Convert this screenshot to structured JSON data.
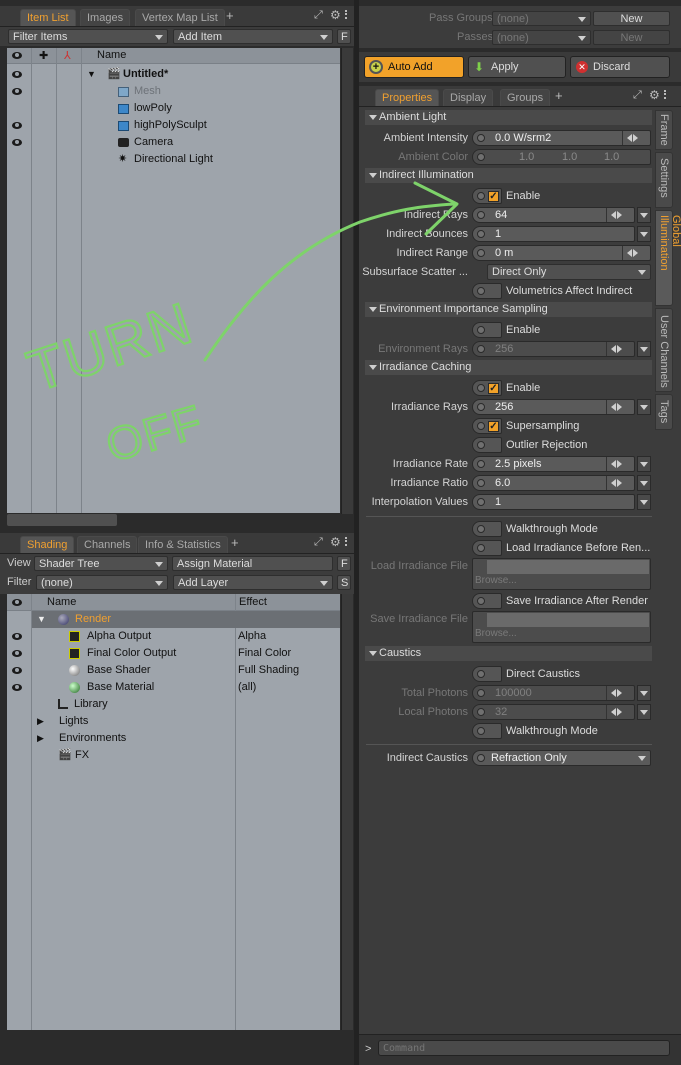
{
  "itemlist": {
    "tabs": [
      "Item List",
      "Images",
      "Vertex Map List"
    ],
    "filter": "Filter Items",
    "add_item": "Add Item",
    "f_btn": "F",
    "col_name": "Name",
    "items": [
      {
        "label": "Untitled*",
        "bold": true
      },
      {
        "label": "Mesh",
        "dim": true
      },
      {
        "label": "lowPoly"
      },
      {
        "label": "highPolySculpt"
      },
      {
        "label": "Camera"
      },
      {
        "label": "Directional Light"
      }
    ]
  },
  "shading": {
    "tabs": [
      "Shading",
      "Channels",
      "Info & Statistics"
    ],
    "view_label": "View",
    "view_value": "Shader Tree",
    "assign": "Assign Material",
    "filter_label": "Filter",
    "filter_value": "(none)",
    "add_layer": "Add Layer",
    "f_btn": "F",
    "s_btn": "S",
    "col_name": "Name",
    "col_effect": "Effect",
    "rows": [
      {
        "name": "Render",
        "effect": ""
      },
      {
        "name": "Alpha Output",
        "effect": "Alpha"
      },
      {
        "name": "Final Color Output",
        "effect": "Final Color"
      },
      {
        "name": "Base Shader",
        "effect": "Full Shading"
      },
      {
        "name": "Base Material",
        "effect": "(all)"
      },
      {
        "name": "Library",
        "effect": ""
      },
      {
        "name": "Lights",
        "effect": ""
      },
      {
        "name": "Environments",
        "effect": ""
      },
      {
        "name": "FX",
        "effect": ""
      }
    ]
  },
  "passes": {
    "groups_label": "Pass Groups",
    "groups_value": "(none)",
    "new1": "New",
    "passes_label": "Passes",
    "passes_value": "(none)",
    "new2": "New"
  },
  "actions": {
    "auto_add": "Auto Add",
    "apply": "Apply",
    "discard": "Discard"
  },
  "props": {
    "tabs": [
      "Properties",
      "Display",
      "Groups"
    ],
    "side_tabs": [
      "Frame",
      "Settings",
      "Global Illumination",
      "User Channels",
      "Tags"
    ],
    "ambient": {
      "title": "Ambient Light",
      "intensity_label": "Ambient Intensity",
      "intensity": "0.0 W/srm2",
      "color_label": "Ambient Color",
      "color": [
        "1.0",
        "1.0",
        "1.0"
      ]
    },
    "indirect": {
      "title": "Indirect Illumination",
      "enable": "Enable",
      "rays_label": "Indirect Rays",
      "rays": "64",
      "bounces_label": "Indirect Bounces",
      "bounces": "1",
      "range_label": "Indirect Range",
      "range": "0 m",
      "sss_label": "Subsurface Scatter ...",
      "sss": "Direct Only",
      "vol": "Volumetrics Affect Indirect"
    },
    "env": {
      "title": "Environment Importance Sampling",
      "enable": "Enable",
      "rays_label": "Environment Rays",
      "rays": "256"
    },
    "irr": {
      "title": "Irradiance Caching",
      "enable": "Enable",
      "rays_label": "Irradiance Rays",
      "rays": "256",
      "super": "Supersampling",
      "outlier": "Outlier Rejection",
      "rate_label": "Irradiance Rate",
      "rate": "2.5 pixels",
      "ratio_label": "Irradiance Ratio",
      "ratio": "6.0",
      "interp_label": "Interpolation Values",
      "interp": "1",
      "walk": "Walkthrough Mode",
      "load_before": "Load Irradiance Before Ren...",
      "load_label": "Load Irradiance File",
      "browse1": "Browse...",
      "save_after": "Save Irradiance After Render",
      "save_label": "Save Irradiance File",
      "browse2": "Browse..."
    },
    "caustics": {
      "title": "Caustics",
      "direct": "Direct Caustics",
      "total_label": "Total Photons",
      "total": "100000",
      "local_label": "Local Photons",
      "local": "32",
      "walk": "Walkthrough Mode",
      "indirect_label": "Indirect Caustics",
      "indirect": "Refraction Only"
    }
  },
  "annotation": {
    "line1": "TURN",
    "line2": "OFF"
  },
  "command": {
    "prompt": ">",
    "placeholder": "Command"
  }
}
